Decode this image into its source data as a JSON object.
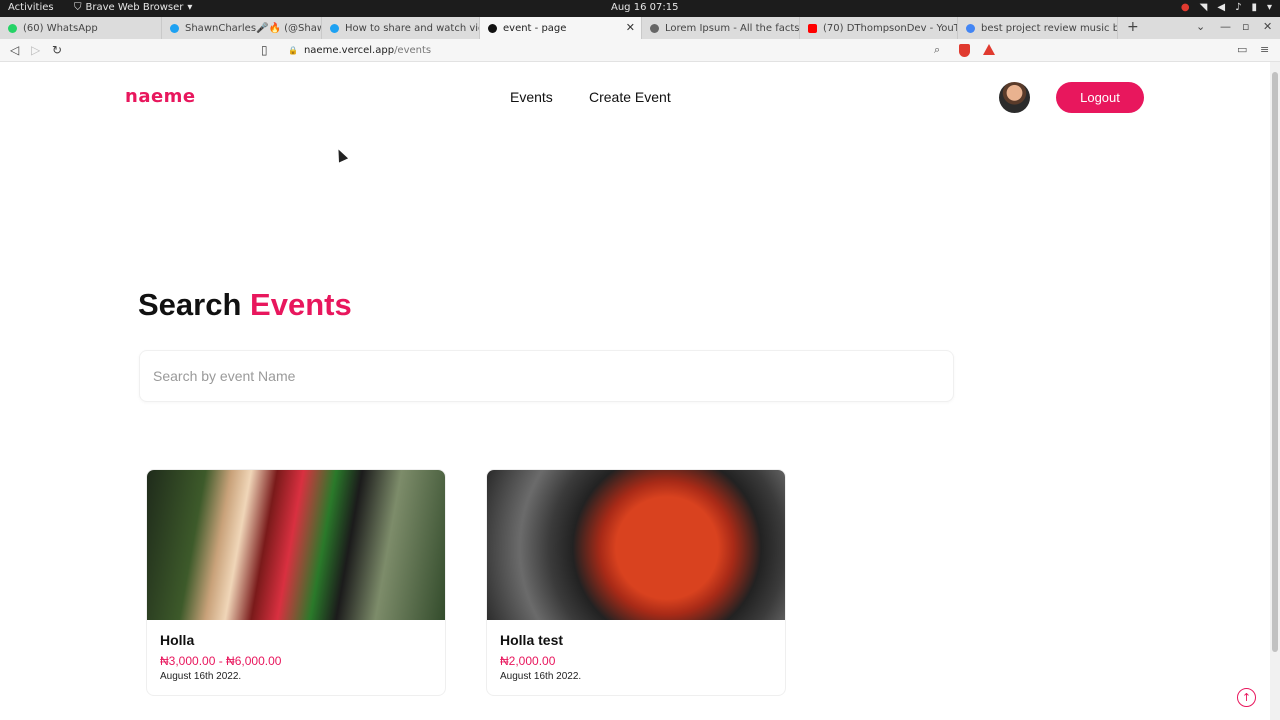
{
  "system": {
    "activities": "Activities",
    "app_name": "Brave Web Browser",
    "clock": "Aug 16  07:15"
  },
  "tabs": [
    {
      "label": "(60) WhatsApp",
      "color": "#25d366"
    },
    {
      "label": "ShawnCharles🎤🔥 (@Shaw",
      "color": "#1da1f2"
    },
    {
      "label": "How to share and watch vide",
      "color": "#1da1f2"
    },
    {
      "label": "event - page",
      "color": "#111111"
    },
    {
      "label": "Lorem Ipsum - All the facts - L",
      "color": "#666666"
    },
    {
      "label": "(70) DThompsonDev - YouTub",
      "color": "#ff0000"
    },
    {
      "label": "best project review music bac",
      "color": "#4285f4"
    }
  ],
  "address": {
    "host": "naeme.vercel.app",
    "path": "/events"
  },
  "site": {
    "logo": "naeme",
    "nav": {
      "events": "Events",
      "create_event": "Create Event"
    },
    "logout": "Logout",
    "accent": "#e8175d"
  },
  "search": {
    "heading_part1": "Search",
    "heading_part2": "Events",
    "placeholder": "Search by event Name",
    "value": ""
  },
  "events": [
    {
      "title": "Holla",
      "price": "₦3,000.00 - ₦6,000.00",
      "date": "August 16th 2022."
    },
    {
      "title": "Holla test",
      "price": "₦2,000.00",
      "date": "August 16th 2022."
    }
  ]
}
